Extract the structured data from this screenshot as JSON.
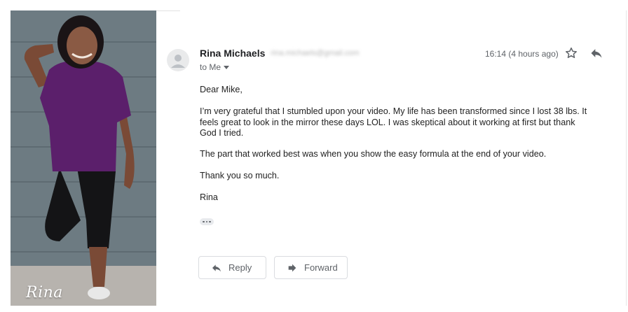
{
  "photo": {
    "caption": "Rina",
    "icon": "person-photo"
  },
  "email": {
    "sender_name": "Rina Michaels",
    "sender_email": "rina.michaels@gmail.com",
    "recipient": "to Me",
    "timestamp": "16:14 (4 hours ago)",
    "greeting": "Dear Mike,",
    "paragraph_1": "I’m very grateful that I stumbled upon your video. My life has been transformed since I lost 38 lbs. It feels great to look in the mirror these days LOL. I was skeptical about it working at first but thank God I tried.",
    "paragraph_2": "The part that worked best was when you show the easy formula at the end of your video.",
    "closing": "Thank you so much.",
    "signature": "Rina"
  },
  "actions": {
    "reply_label": "Reply",
    "forward_label": "Forward"
  },
  "colors": {
    "text": "#202124",
    "muted": "#5f6368",
    "border": "#dadce0",
    "photo_wall": "#6f7d84",
    "shirt": "#5b1f6b"
  }
}
